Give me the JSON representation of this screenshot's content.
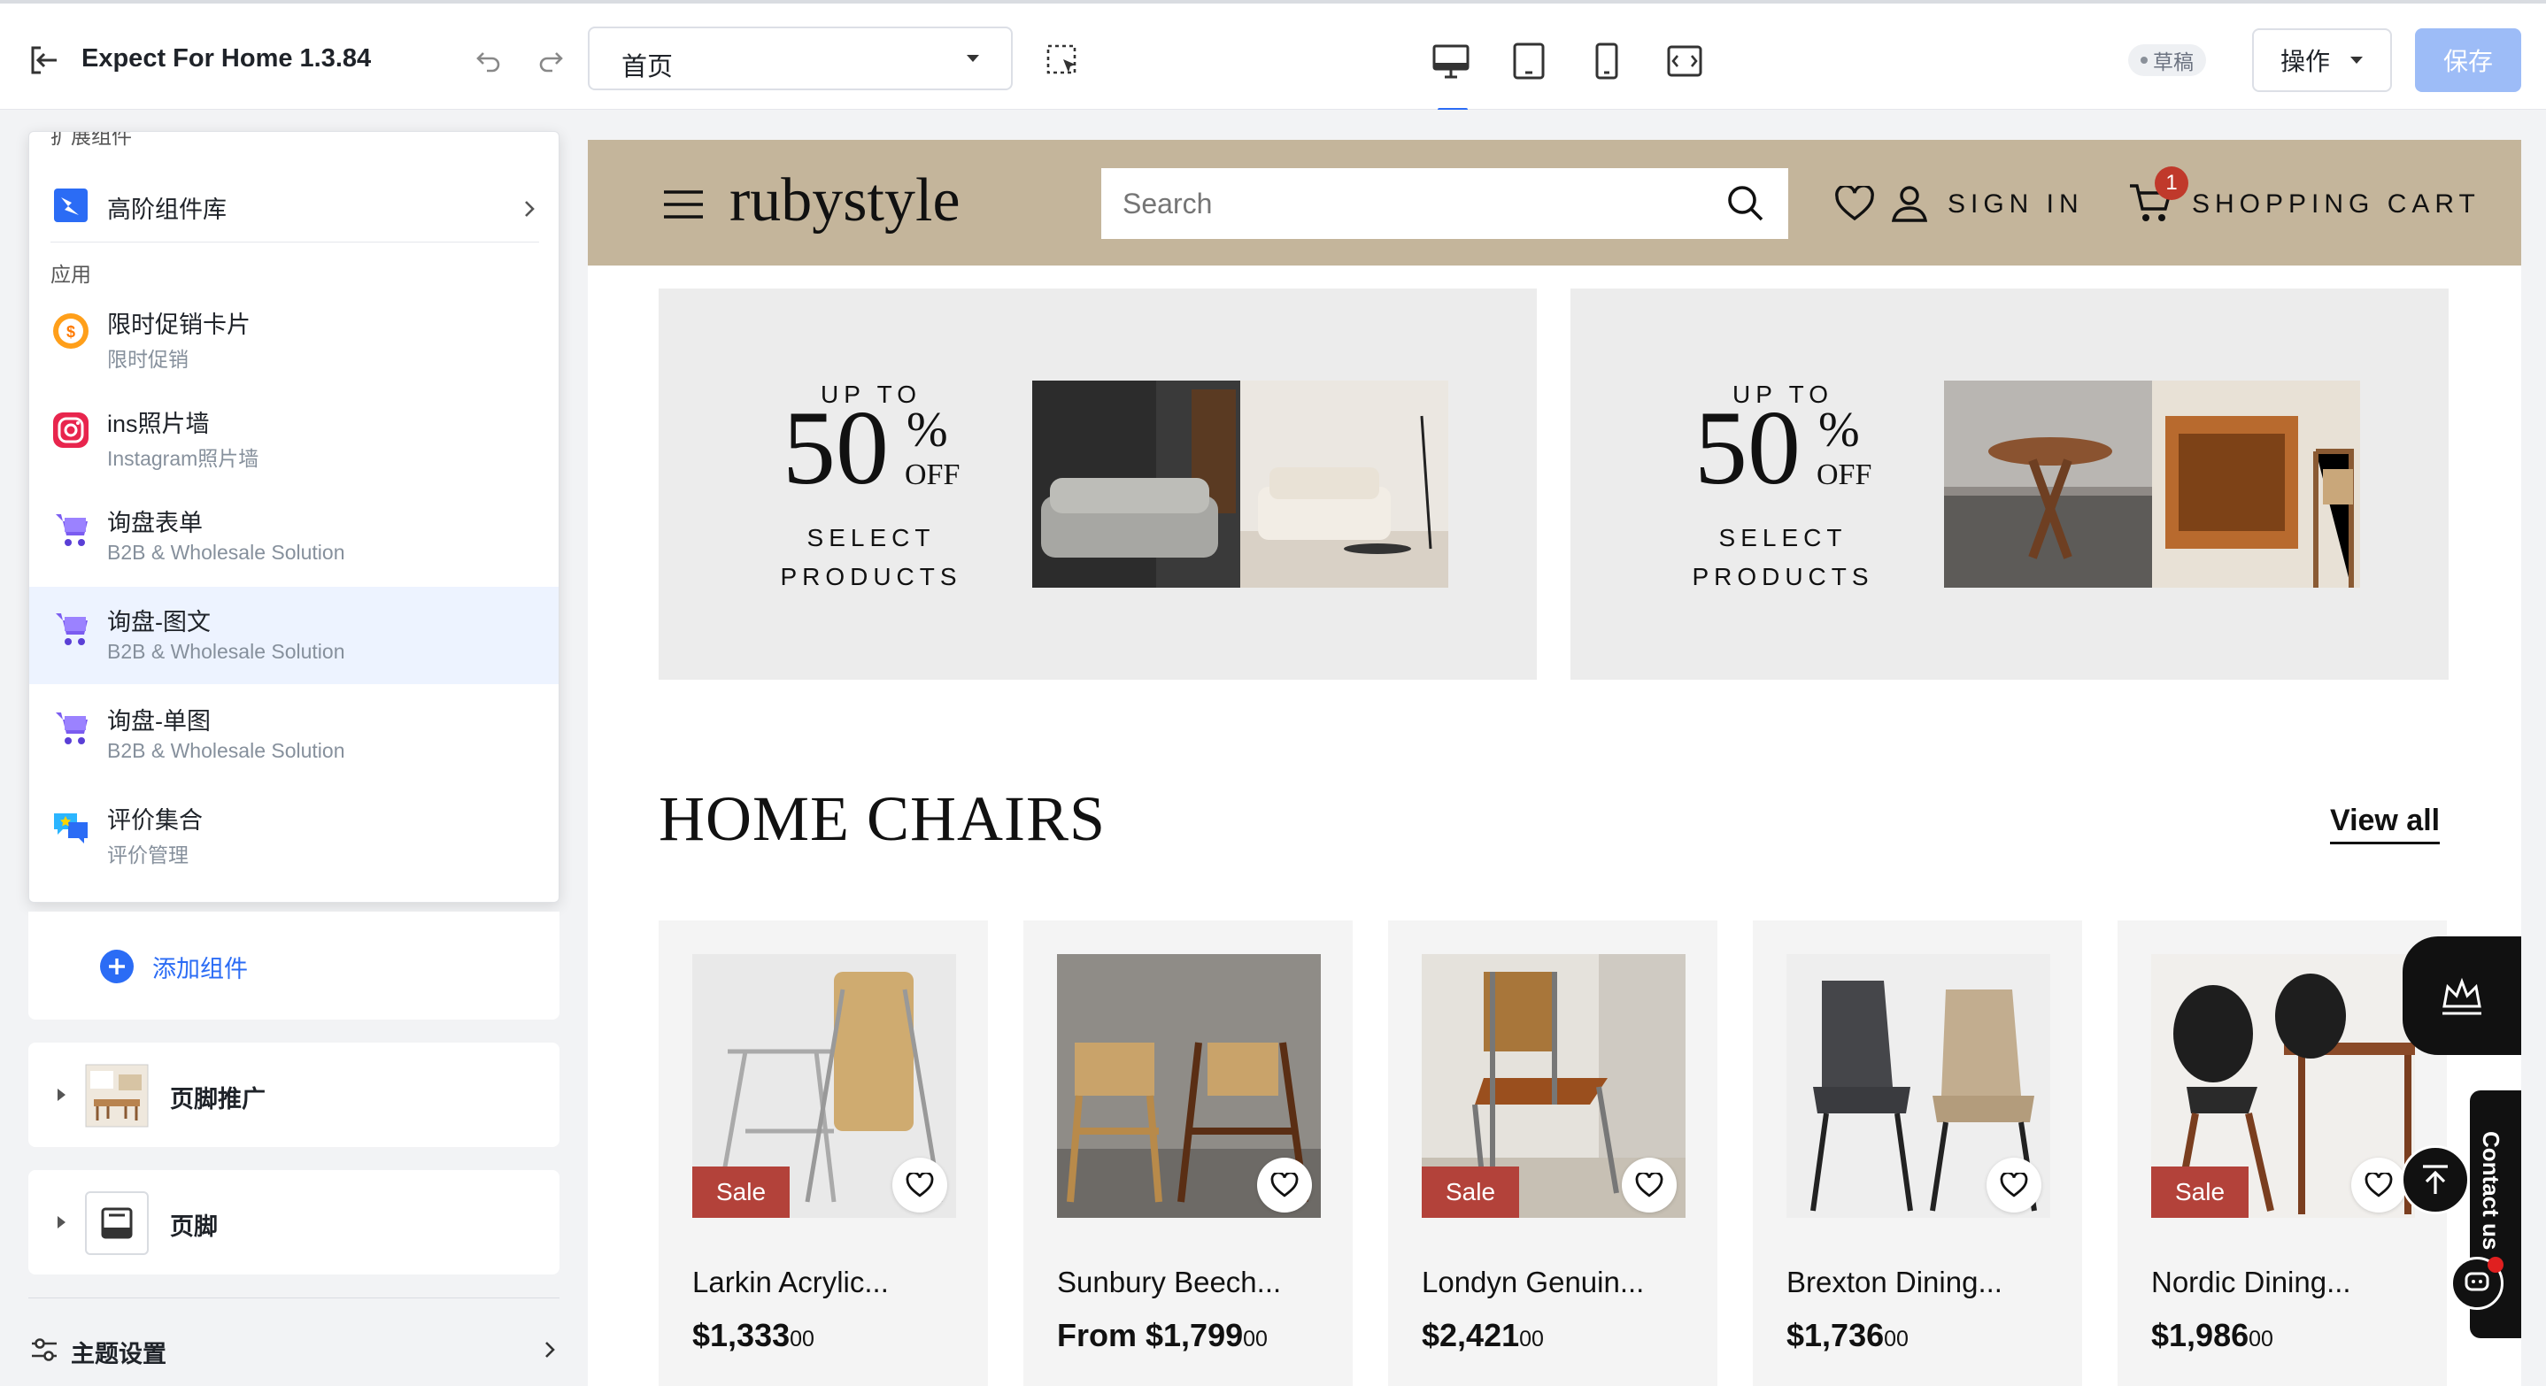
{
  "editor": {
    "app_title": "Expect For Home 1.3.84",
    "page_select": "首页",
    "status_badge": "草稿",
    "actions_label": "操作",
    "save_label": "保存"
  },
  "sidebar": {
    "partial_header": "扩展组件",
    "advanced_lib": "高阶组件库",
    "section_apps": "应用",
    "items": [
      {
        "title": "限时促销卡片",
        "subtitle": "限时促销",
        "icon": "coin-icon"
      },
      {
        "title": "ins照片墙",
        "subtitle": "Instagram照片墙",
        "icon": "instagram-icon"
      },
      {
        "title": "询盘表单",
        "subtitle": "B2B & Wholesale Solution",
        "icon": "cart-icon"
      },
      {
        "title": "询盘-图文",
        "subtitle": "B2B & Wholesale Solution",
        "icon": "cart-icon"
      },
      {
        "title": "询盘-单图",
        "subtitle": "B2B & Wholesale Solution",
        "icon": "cart-icon"
      },
      {
        "title": "评价集合",
        "subtitle": "评价管理",
        "icon": "review-icon"
      }
    ],
    "add_component": "添加组件",
    "footer_promo": "页脚推广",
    "footer": "页脚",
    "theme_settings": "主题设置"
  },
  "site": {
    "logo": "rubystyle",
    "search_placeholder": "Search",
    "sign_in": "SIGN IN",
    "cart_label": "SHOPPING CART",
    "cart_count": "1",
    "banners": [
      {
        "line1": "UP TO",
        "number": "50",
        "pct": "%",
        "off": "OFF",
        "line2": "SELECT",
        "line3": "PRODUCTS"
      },
      {
        "line1": "UP TO",
        "number": "50",
        "pct": "%",
        "off": "OFF",
        "line2": "SELECT",
        "line3": "PRODUCTS"
      }
    ],
    "section_title": "HOME CHAIRS",
    "view_all": "View all",
    "products": [
      {
        "name": "Larkin Acrylic...",
        "price": "$1,333",
        "cents": "00",
        "sale": true
      },
      {
        "name": "Sunbury Beech...",
        "price": "From $1,799",
        "cents": "00",
        "sale": false
      },
      {
        "name": "Londyn Genuin...",
        "price": "$2,421",
        "cents": "00",
        "sale": true
      },
      {
        "name": "Brexton Dining...",
        "price": "$1,736",
        "cents": "00",
        "sale": false
      },
      {
        "name": "Nordic Dining...",
        "price": "$1,986",
        "cents": "00",
        "sale": true
      }
    ],
    "sale_label": "Sale",
    "contact_us": "Contact us"
  },
  "colors": {
    "accent": "#2b6cf5",
    "save_disabled": "#9dbcf7",
    "header_bg": "#c4b59b",
    "sale_red": "#b3423a"
  }
}
